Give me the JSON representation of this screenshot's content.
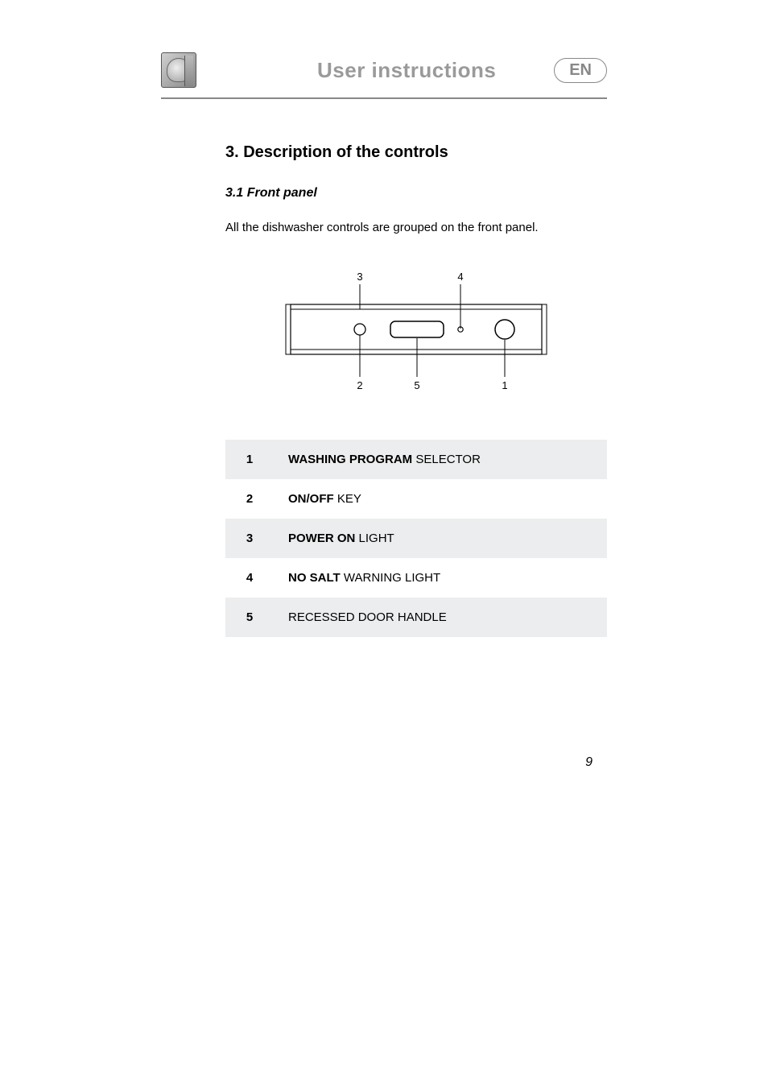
{
  "header": {
    "title": "User instructions",
    "lang": "EN"
  },
  "section": {
    "title": "3.  Description of the controls",
    "subsection": "3.1 Front panel",
    "intro": "All the dishwasher controls are grouped on the front panel."
  },
  "diagram": {
    "top_labels": [
      "3",
      "4"
    ],
    "bottom_labels": [
      "2",
      "5",
      "1"
    ]
  },
  "controls": [
    {
      "num": "1",
      "bold": "WASHING PROGRAM",
      "rest": " SELECTOR"
    },
    {
      "num": "2",
      "bold": "ON/OFF",
      "rest": " KEY"
    },
    {
      "num": "3",
      "bold": "POWER ON",
      "rest": " LIGHT"
    },
    {
      "num": "4",
      "bold": "NO SALT",
      "rest": " WARNING LIGHT"
    },
    {
      "num": "5",
      "bold": "",
      "rest": "RECESSED DOOR HANDLE"
    }
  ],
  "page_number": "9"
}
